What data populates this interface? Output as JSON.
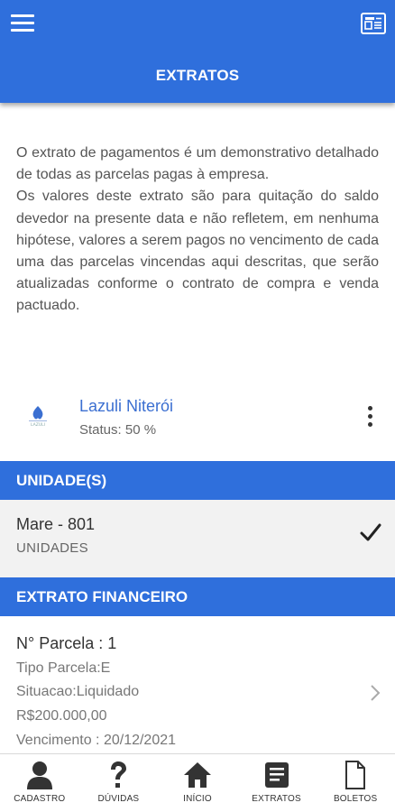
{
  "header": {
    "title": "EXTRATOS",
    "menu_icon": "hamburger-menu-icon",
    "right_icon": "newspaper-icon"
  },
  "intro": {
    "paragraph1": "O extrato de pagamentos é um demonstrativo detalhado de todas as parcelas pagas à empresa.",
    "paragraph2": "Os valores deste extrato são para quitação do saldo devedor na presente data e não refletem, em nenhuma hipótese, valores a serem pagos no vencimento de cada uma das parcelas vincendas aqui descritas, que serão atualizadas conforme o contrato de compra e venda pactuado."
  },
  "project": {
    "name": "Lazuli Niterói",
    "status": "Status: 50 %",
    "logo_text": "LAZULI"
  },
  "sections": {
    "units": "UNIDADE(S)",
    "financial": "EXTRATO FINANCEIRO"
  },
  "unit": {
    "name": "Mare - 801",
    "type": "UNIDADES",
    "selected": true
  },
  "parcel": {
    "number": "N° Parcela : 1",
    "type": "Tipo Parcela:E",
    "situation": "Situacao:Liquidado",
    "amount": "R$200.000,00",
    "due": "Vencimento : 20/12/2021"
  },
  "tabbar": {
    "items": [
      {
        "label": "CADASTRO",
        "icon": "person-icon"
      },
      {
        "label": "DÚVIDAS",
        "icon": "question-icon"
      },
      {
        "label": "INÍCIO",
        "icon": "home-icon"
      },
      {
        "label": "EXTRATOS",
        "icon": "document-list-icon"
      },
      {
        "label": "BOLETOS",
        "icon": "file-icon"
      }
    ]
  },
  "colors": {
    "primary": "#2f6fdc",
    "link": "#3b6fd1",
    "row_bg": "#f2f2f2"
  }
}
